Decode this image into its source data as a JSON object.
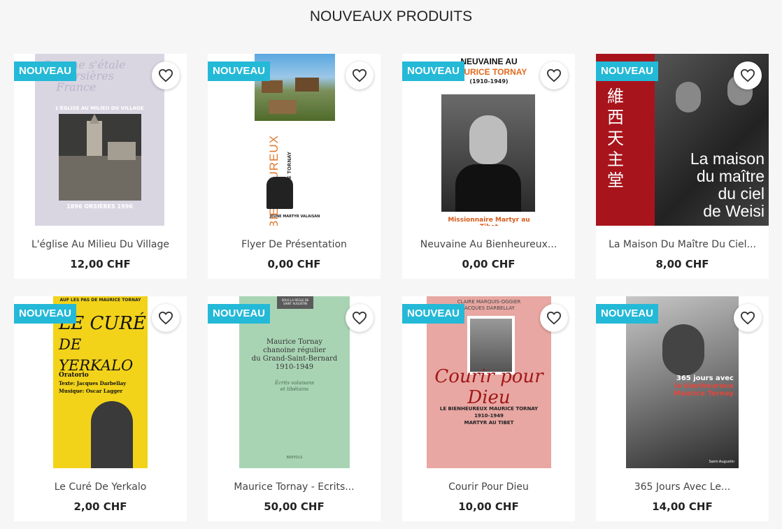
{
  "section_title": "NOUVEAUX PRODUITS",
  "badge_label": "NOUVEAU",
  "colors": {
    "badge": "#24b9d7",
    "background": "#f6f6f6"
  },
  "icons": {
    "wishlist": "heart-outline-icon"
  },
  "products": [
    {
      "name": "L'église Au Milieu Du Village",
      "price": "12,00 CHF",
      "cover": {
        "line1": "L'ÉGLISE AU MILIEU DU VILLAGE",
        "line2": "1896    ORSIÈRES    1996"
      }
    },
    {
      "name": "Flyer De Présentation",
      "price": "0,00 CHF",
      "cover": {
        "line1": "BIENHEUREUX",
        "line2": "MAURICE TORNAY",
        "line3": "JEUNE MARTYR VALAISAN"
      }
    },
    {
      "name": "Neuvaine Au Bienheureux...",
      "price": "0,00 CHF",
      "cover": {
        "line1": "NEUVAINE AU",
        "line2": "MAURICE TORNAY",
        "line3": "(1910-1949)",
        "line4": "Missionnaire Martyr au Tibet"
      }
    },
    {
      "name": "La Maison Du Maître Du Ciel...",
      "price": "8,00 CHF",
      "cover": {
        "line1": "La maison",
        "line2": "du maître",
        "line3": "du ciel",
        "line4": "de Weisi"
      }
    },
    {
      "name": "Le Curé De Yerkalo",
      "price": "2,00 CHF",
      "cover": {
        "line1": "AUF LES PAS DE MAURICE TORNAY",
        "line2": "LE CURÉ",
        "line3": "DE YERKALO",
        "line4": "Oratorio",
        "line5": "Texte: Jacques Darbellay",
        "line6": "Musique: Oscar Lagger"
      }
    },
    {
      "name": "Maurice Tornay - Ecrits...",
      "price": "50,00 CHF",
      "cover": {
        "line1": "SOUS LA RÈGLE DE SAINT AUGUSTIN",
        "line2": "Maurice Tornay",
        "line3": "chanoine régulier",
        "line4": "du Grand-Saint-Bernard",
        "line5": "1910-1949",
        "line6": "Écrits valaisans",
        "line7": "et tibétains",
        "line8": "BREPOLS"
      }
    },
    {
      "name": "Courir Pour Dieu",
      "price": "10,00 CHF",
      "cover": {
        "line1": "CLAIRE MARQUIS-OGGIER",
        "line2": "JACQUES DARBELLAY",
        "line3": "Courir pour Dieu",
        "line4": "LE BIENHEUREUX MAURICE TORNAY",
        "line5": "1910-1949",
        "line6": "MARTYR AU TIBET"
      }
    },
    {
      "name": "365 Jours Avec Le...",
      "price": "14,00 CHF",
      "cover": {
        "line1": "365 jours avec",
        "line2": "le bienheureux",
        "line3": "Maurice Tornay",
        "line4": "Saint-Augustin"
      }
    }
  ]
}
